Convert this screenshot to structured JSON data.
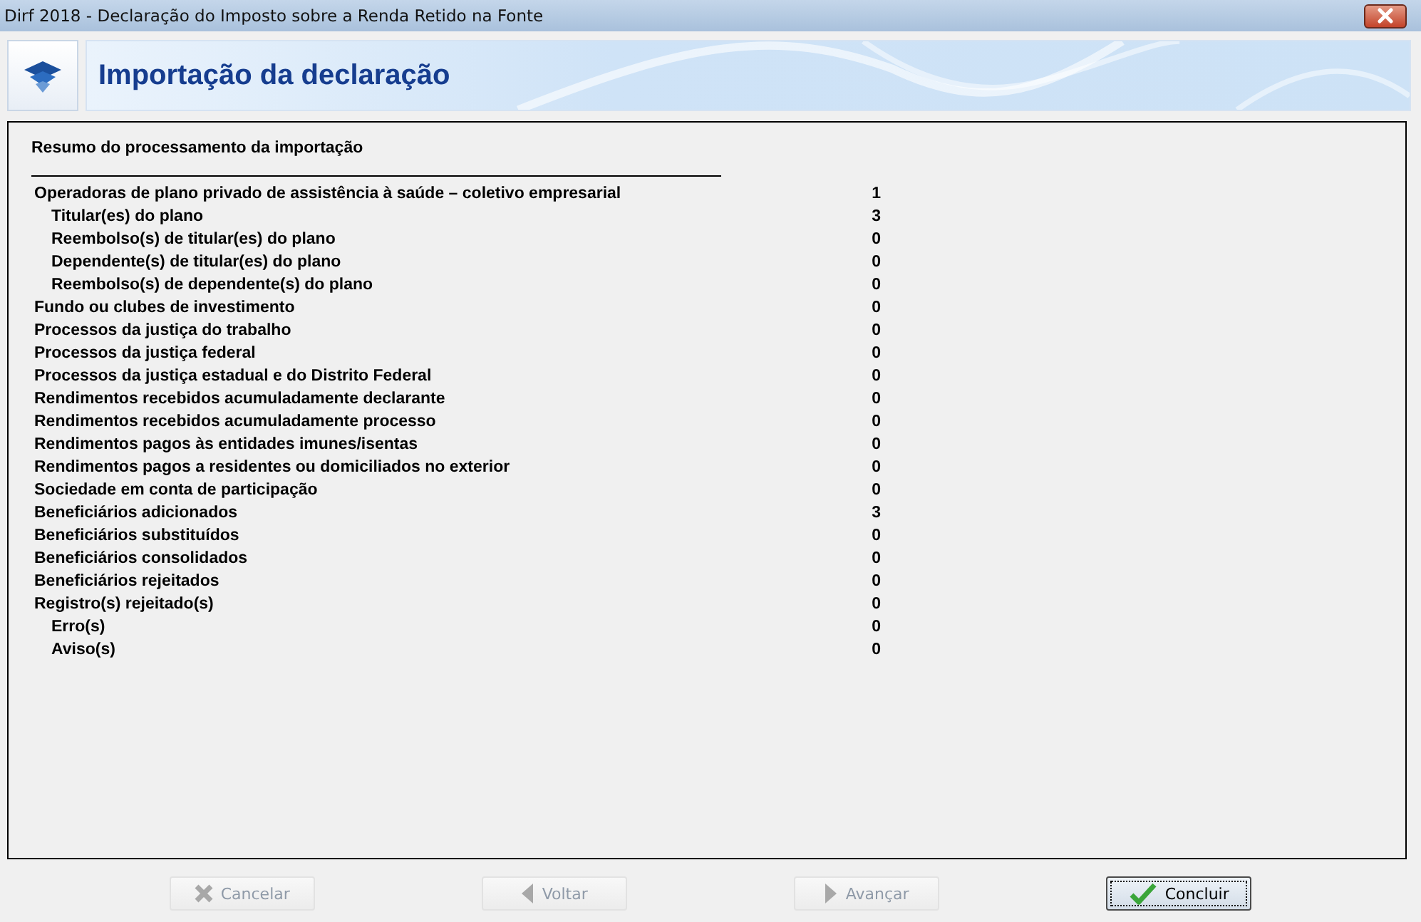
{
  "window": {
    "title": "Dirf 2018 - Declaração do Imposto sobre a Renda Retido na Fonte"
  },
  "header": {
    "title": "Importação da declaração"
  },
  "summary": {
    "title": "Resumo do processamento da importação",
    "rows": [
      {
        "label": "Operadoras de plano privado de assistência à saúde – coletivo empresarial",
        "value": "1",
        "children": [
          {
            "label": "Titular(es) do plano",
            "value": "3"
          },
          {
            "label": "Reembolso(s) de titular(es) do plano",
            "value": "0"
          },
          {
            "label": "Dependente(s) de titular(es) do plano",
            "value": "0"
          },
          {
            "label": "Reembolso(s) de dependente(s) do plano",
            "value": "0"
          }
        ]
      },
      {
        "label": "Fundo ou clubes de investimento",
        "value": "0"
      },
      {
        "label": "Processos da justiça do trabalho",
        "value": "0"
      },
      {
        "label": "Processos da justiça federal",
        "value": "0"
      },
      {
        "label": "Processos da justiça estadual e do Distrito Federal",
        "value": "0"
      },
      {
        "label": "Rendimentos recebidos acumuladamente declarante",
        "value": "0"
      },
      {
        "label": "Rendimentos recebidos acumuladamente processo",
        "value": "0"
      },
      {
        "label": "Rendimentos pagos às entidades imunes/isentas",
        "value": "0"
      },
      {
        "label": "Rendimentos pagos a residentes ou domiciliados no exterior",
        "value": "0"
      },
      {
        "label": "Sociedade em conta de participação",
        "value": "0"
      },
      {
        "label": "Beneficiários adicionados",
        "value": "3"
      },
      {
        "label": "Beneficiários substituídos",
        "value": "0"
      },
      {
        "label": "Beneficiários consolidados",
        "value": "0"
      },
      {
        "label": "Beneficiários rejeitados",
        "value": "0"
      },
      {
        "label": "Registro(s) rejeitado(s)",
        "value": "0",
        "children": [
          {
            "label": "Erro(s)",
            "value": "0"
          },
          {
            "label": "Aviso(s)",
            "value": "0"
          }
        ]
      }
    ]
  },
  "buttons": [
    {
      "kind": "cancel",
      "label": "Cancelar",
      "disabled": true
    },
    {
      "kind": "back",
      "label": "Voltar",
      "disabled": true
    },
    {
      "kind": "next",
      "label": "Avançar",
      "disabled": true
    },
    {
      "kind": "finish",
      "label": "Concluir",
      "disabled": false
    }
  ]
}
